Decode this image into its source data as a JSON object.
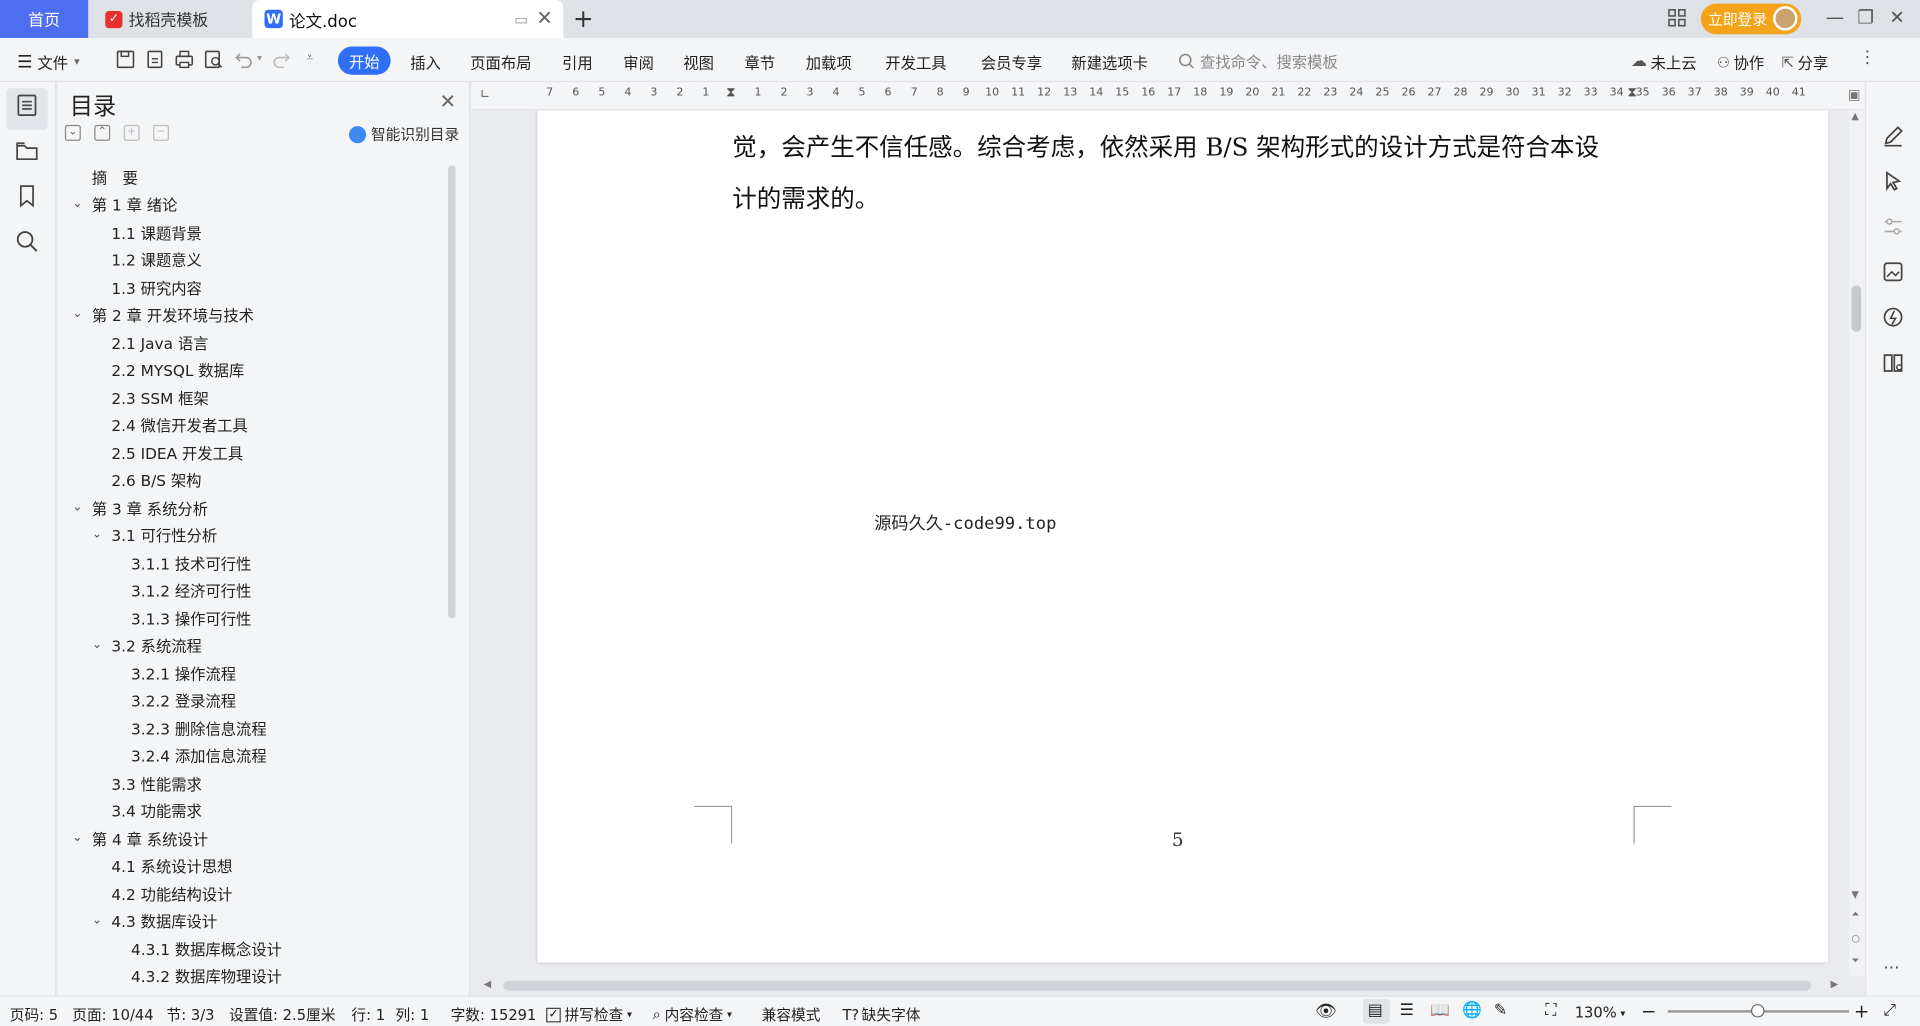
{
  "titlebar": {
    "tabs": [
      {
        "label": "首页"
      },
      {
        "label": "找稻壳模板"
      },
      {
        "label": "论文.doc"
      }
    ],
    "login_label": "立即登录"
  },
  "menubar": {
    "file_label": "文件",
    "items": [
      "开始",
      "插入",
      "页面布局",
      "引用",
      "审阅",
      "视图",
      "章节",
      "加载项",
      "开发工具",
      "会员专享",
      "新建选项卡"
    ],
    "search_placeholder": "查找命令、搜索模板",
    "cloud_label": "未上云",
    "collab_label": "协作",
    "share_label": "分享"
  },
  "toc": {
    "title": "目录",
    "smart_label": "智能识别目录",
    "items": [
      "摘　要",
      "第 1 章  绪论",
      "1.1  课题背景",
      "1.2  课题意义",
      "1.3  研究内容",
      "第 2 章  开发环境与技术",
      "2.1 Java 语言",
      "2.2 MYSQL 数据库",
      "2.3 SSM 框架",
      "2.4 微信开发者工具",
      "2.5 IDEA 开发工具",
      "2.6 B/S 架构",
      "第 3 章  系统分析",
      "3.1  可行性分析",
      "3.1.1  技术可行性",
      "3.1.2  经济可行性",
      "3.1.3  操作可行性",
      "3.2  系统流程",
      "3.2.1  操作流程",
      "3.2.2  登录流程",
      "3.2.3  删除信息流程",
      "3.2.4  添加信息流程",
      "3.3  性能需求",
      "3.4  功能需求",
      "第 4 章  系统设计",
      "4.1  系统设计思想",
      "4.2  功能结构设计",
      "4.3  数据库设计",
      "4.3.1  数据库概念设计",
      "4.3.2  数据库物理设计"
    ]
  },
  "ruler": {
    "ticks": [
      "7",
      "6",
      "5",
      "4",
      "3",
      "2",
      "1",
      "",
      "1",
      "2",
      "3",
      "4",
      "5",
      "6",
      "7",
      "8",
      "9",
      "10",
      "11",
      "12",
      "13",
      "14",
      "15",
      "16",
      "17",
      "18",
      "19",
      "20",
      "21",
      "22",
      "23",
      "24",
      "25",
      "26",
      "27",
      "28",
      "29",
      "30",
      "31",
      "32",
      "33",
      "34",
      "35",
      "36",
      "37",
      "38",
      "39",
      "40",
      "41"
    ]
  },
  "document": {
    "line1": "觉，会产生不信任感。综合考虑，依然采用 B/S 架构形式的设计方式是符合本设",
    "line2": "计的需求的。",
    "watermark": "源码久久-code99.top",
    "page_number": "5"
  },
  "statusbar": {
    "page": "页码: 5",
    "pages": "页面: 10/44",
    "section": "节: 3/3",
    "setting": "设置值: 2.5厘米",
    "row": "行: 1",
    "col": "列: 1",
    "words": "字数: 15291",
    "spell": "拼写检查",
    "content_check": "内容检查",
    "compat": "兼容模式",
    "missing_font": "缺失字体",
    "zoom": "130%"
  }
}
